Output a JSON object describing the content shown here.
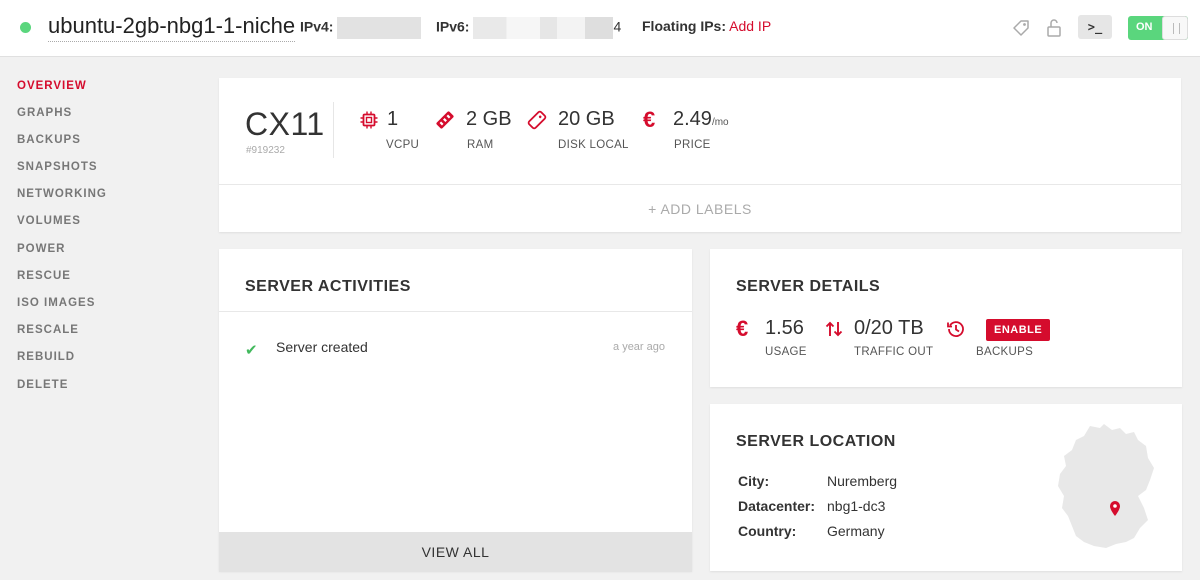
{
  "header": {
    "server_name": "ubuntu-2gb-nbg1-1-niche",
    "status_color": "#5ad67d",
    "ipv4_label": "IPv4:",
    "ipv6_label": "IPv6:",
    "ipv6_suffix": "4",
    "floating_label": "Floating IPs:",
    "add_ip": "Add IP",
    "console_label": ">_",
    "power_label": "ON"
  },
  "sidebar": {
    "items": [
      {
        "label": "OVERVIEW",
        "active": true
      },
      {
        "label": "GRAPHS"
      },
      {
        "label": "BACKUPS"
      },
      {
        "label": "SNAPSHOTS"
      },
      {
        "label": "NETWORKING"
      },
      {
        "label": "VOLUMES"
      },
      {
        "label": "POWER"
      },
      {
        "label": "RESCUE"
      },
      {
        "label": "ISO IMAGES"
      },
      {
        "label": "RESCALE"
      },
      {
        "label": "REBUILD"
      },
      {
        "label": "DELETE"
      }
    ]
  },
  "plan": {
    "name": "CX11",
    "id": "#919232",
    "specs": [
      {
        "icon": "cpu-icon",
        "value": "1",
        "label": "VCPU"
      },
      {
        "icon": "ram-icon",
        "value": "2 GB",
        "label": "RAM"
      },
      {
        "icon": "disk-icon",
        "value": "20 GB",
        "label": "DISK LOCAL"
      },
      {
        "icon": "euro-icon",
        "value": "2.49",
        "unit": "/mo",
        "label": "PRICE"
      }
    ],
    "add_labels": "+ ADD LABELS"
  },
  "activities": {
    "title": "SERVER ACTIVITIES",
    "items": [
      {
        "icon": "check-icon",
        "text": "Server created",
        "time": "a year ago"
      }
    ],
    "view_all": "VIEW ALL"
  },
  "details": {
    "title": "SERVER DETAILS",
    "usage_value": "1.56",
    "usage_label": "USAGE",
    "traffic_value": "0/20 TB",
    "traffic_label": "TRAFFIC OUT",
    "backups_button": "ENABLE",
    "backups_label": "BACKUPS"
  },
  "location": {
    "title": "SERVER LOCATION",
    "city_key": "City:",
    "city": "Nuremberg",
    "datacenter_key": "Datacenter:",
    "datacenter": "nbg1-dc3",
    "country_key": "Country:",
    "country": "Germany"
  },
  "colors": {
    "accent": "#d50c2d",
    "success": "#42b95d",
    "toggle_on": "#5ad67d"
  }
}
